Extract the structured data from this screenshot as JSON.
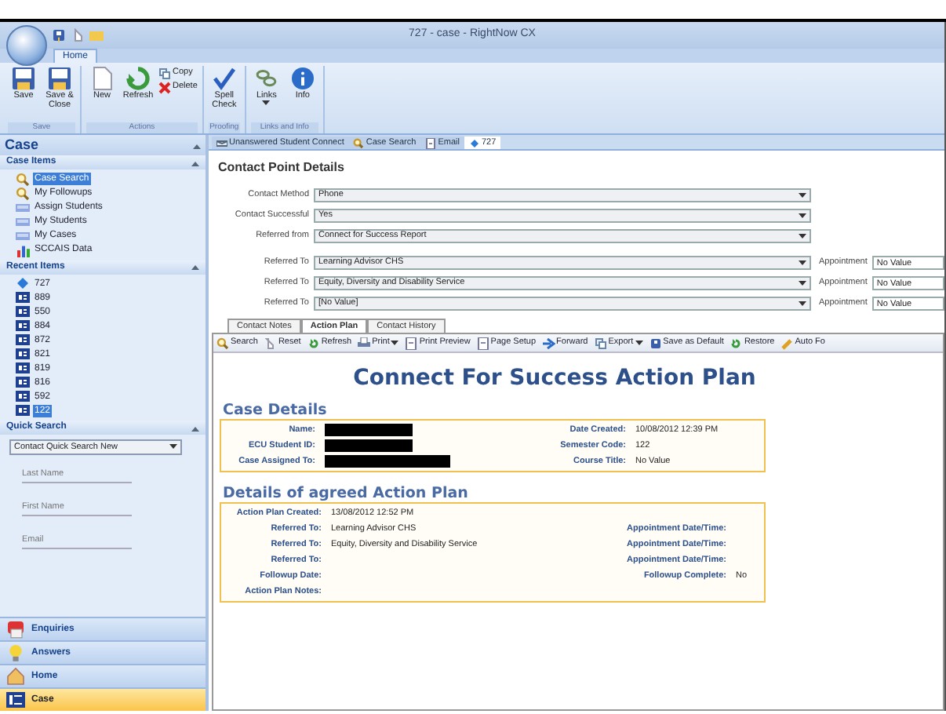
{
  "window": {
    "title": "727 - case - RightNow CX"
  },
  "ribbon": {
    "tabs": [
      {
        "label": "Home",
        "selected": true
      }
    ],
    "groups": [
      {
        "label": "Save",
        "buttons": [
          {
            "label": "Save"
          },
          {
            "label": "Save & Close"
          }
        ]
      },
      {
        "label": "Actions",
        "buttons": [
          {
            "label": "New"
          },
          {
            "label": "Refresh"
          }
        ],
        "small_buttons": [
          "Copy",
          "Delete"
        ]
      },
      {
        "label": "Proofing",
        "buttons": [
          {
            "label": "Spell Check"
          }
        ]
      },
      {
        "label": "Links and Info",
        "buttons": [
          {
            "label": "Links",
            "dropdown": true
          },
          {
            "label": "Info",
            "dropdown": false
          }
        ]
      }
    ]
  },
  "sidebar": {
    "title": "Case",
    "sections": [
      {
        "title": "Case Items",
        "items": [
          {
            "label": "Case Search",
            "selected": true
          },
          {
            "label": "My Followups",
            "selected": false
          },
          {
            "label": "Assign Students",
            "selected": false
          },
          {
            "label": "My Students",
            "selected": false
          },
          {
            "label": "My Cases",
            "selected": false
          },
          {
            "label": "SCCAIS Data",
            "selected": false
          }
        ]
      },
      {
        "title": "Recent Items",
        "items": [
          {
            "label": "727",
            "selected": false
          },
          {
            "label": "889",
            "selected": false
          },
          {
            "label": "550",
            "selected": false
          },
          {
            "label": "884",
            "selected": false
          },
          {
            "label": "872",
            "selected": false
          },
          {
            "label": "821",
            "selected": false
          },
          {
            "label": "819",
            "selected": false
          },
          {
            "label": "816",
            "selected": false
          },
          {
            "label": "592",
            "selected": false
          },
          {
            "label": "122",
            "selected": true
          }
        ]
      }
    ],
    "quick_search": {
      "title": "Quick Search",
      "report": "Contact Quick Search New",
      "fields": [
        {
          "placeholder": "Last Name"
        },
        {
          "placeholder": "First Name"
        },
        {
          "placeholder": "Email"
        }
      ]
    },
    "nav": [
      {
        "label": "Enquiries",
        "selected": false
      },
      {
        "label": "Answers",
        "selected": false
      },
      {
        "label": "Home",
        "selected": false
      },
      {
        "label": "Case",
        "selected": true
      }
    ]
  },
  "document_tabs": [
    {
      "label": "Unanswered Student Connect",
      "selected": false
    },
    {
      "label": "Case Search",
      "selected": false
    },
    {
      "label": "Email",
      "selected": false
    },
    {
      "label": "727",
      "selected": true
    }
  ],
  "contact_point": {
    "title": "Contact Point Details",
    "fields": [
      {
        "label": "Contact Method",
        "value": "Phone"
      },
      {
        "label": "Contact Successful",
        "value": "Yes"
      },
      {
        "label": "Referred from",
        "value": "Connect for Success Report"
      }
    ],
    "referrals": [
      {
        "label": "Referred To",
        "value": "Learning Advisor CHS",
        "appointment_label": "Appointment",
        "appointment": "No Value"
      },
      {
        "label": "Referred To",
        "value": "Equity, Diversity and Disability Service",
        "appointment_label": "Appointment",
        "appointment": "No Value"
      },
      {
        "label": "Referred To",
        "value": "[No Value]",
        "appointment_label": "Appointment",
        "appointment": "No Value"
      }
    ]
  },
  "sub_tabs": [
    {
      "label": "Contact Notes",
      "selected": false
    },
    {
      "label": "Action Plan",
      "selected": true
    },
    {
      "label": "Contact History",
      "selected": false
    }
  ],
  "toolbar": [
    {
      "label": "Search",
      "dropdown": false
    },
    {
      "label": "Reset",
      "dropdown": false
    },
    {
      "label": "Refresh",
      "dropdown": false
    },
    {
      "label": "Print",
      "dropdown": true
    },
    {
      "label": "Print Preview",
      "dropdown": false
    },
    {
      "label": "Page Setup",
      "dropdown": false
    },
    {
      "label": "Forward",
      "dropdown": false
    },
    {
      "label": "Export",
      "dropdown": true
    },
    {
      "label": "Save as Default",
      "dropdown": false
    },
    {
      "label": "Restore",
      "dropdown": false
    },
    {
      "label": "Auto Fo",
      "dropdown": false
    }
  ],
  "report": {
    "title": "Connect For Success Action Plan",
    "case_details": {
      "heading": "Case Details",
      "rows": [
        {
          "label": "Name:",
          "redacted": true,
          "label_2": "Date Created:",
          "value_2": "10/08/2012 12:39 PM"
        },
        {
          "label": "ECU Student ID:",
          "redacted": true,
          "label_2": "Semester Code:",
          "value_2": "122"
        },
        {
          "label": "Case Assigned To:",
          "redacted": true,
          "label_2": "Course Title:",
          "value_2": "No Value"
        }
      ]
    },
    "action_plan": {
      "heading": "Details of agreed Action Plan",
      "rows": [
        {
          "label": "Action Plan Created:",
          "value": "13/08/2012 12:52 PM"
        },
        {
          "label": "Referred To:",
          "value": "Learning Advisor CHS",
          "label_2": "Appointment Date/Time:"
        },
        {
          "label": "Referred To:",
          "value": "Equity, Diversity and Disability Service",
          "label_2": "Appointment Date/Time:"
        },
        {
          "label": "Referred To:",
          "label_2": "Appointment Date/Time:"
        },
        {
          "label": "Followup Date:",
          "label_2": "Followup Complete:",
          "value_2": "No"
        },
        {
          "label": "Action Plan Notes:"
        }
      ]
    }
  }
}
